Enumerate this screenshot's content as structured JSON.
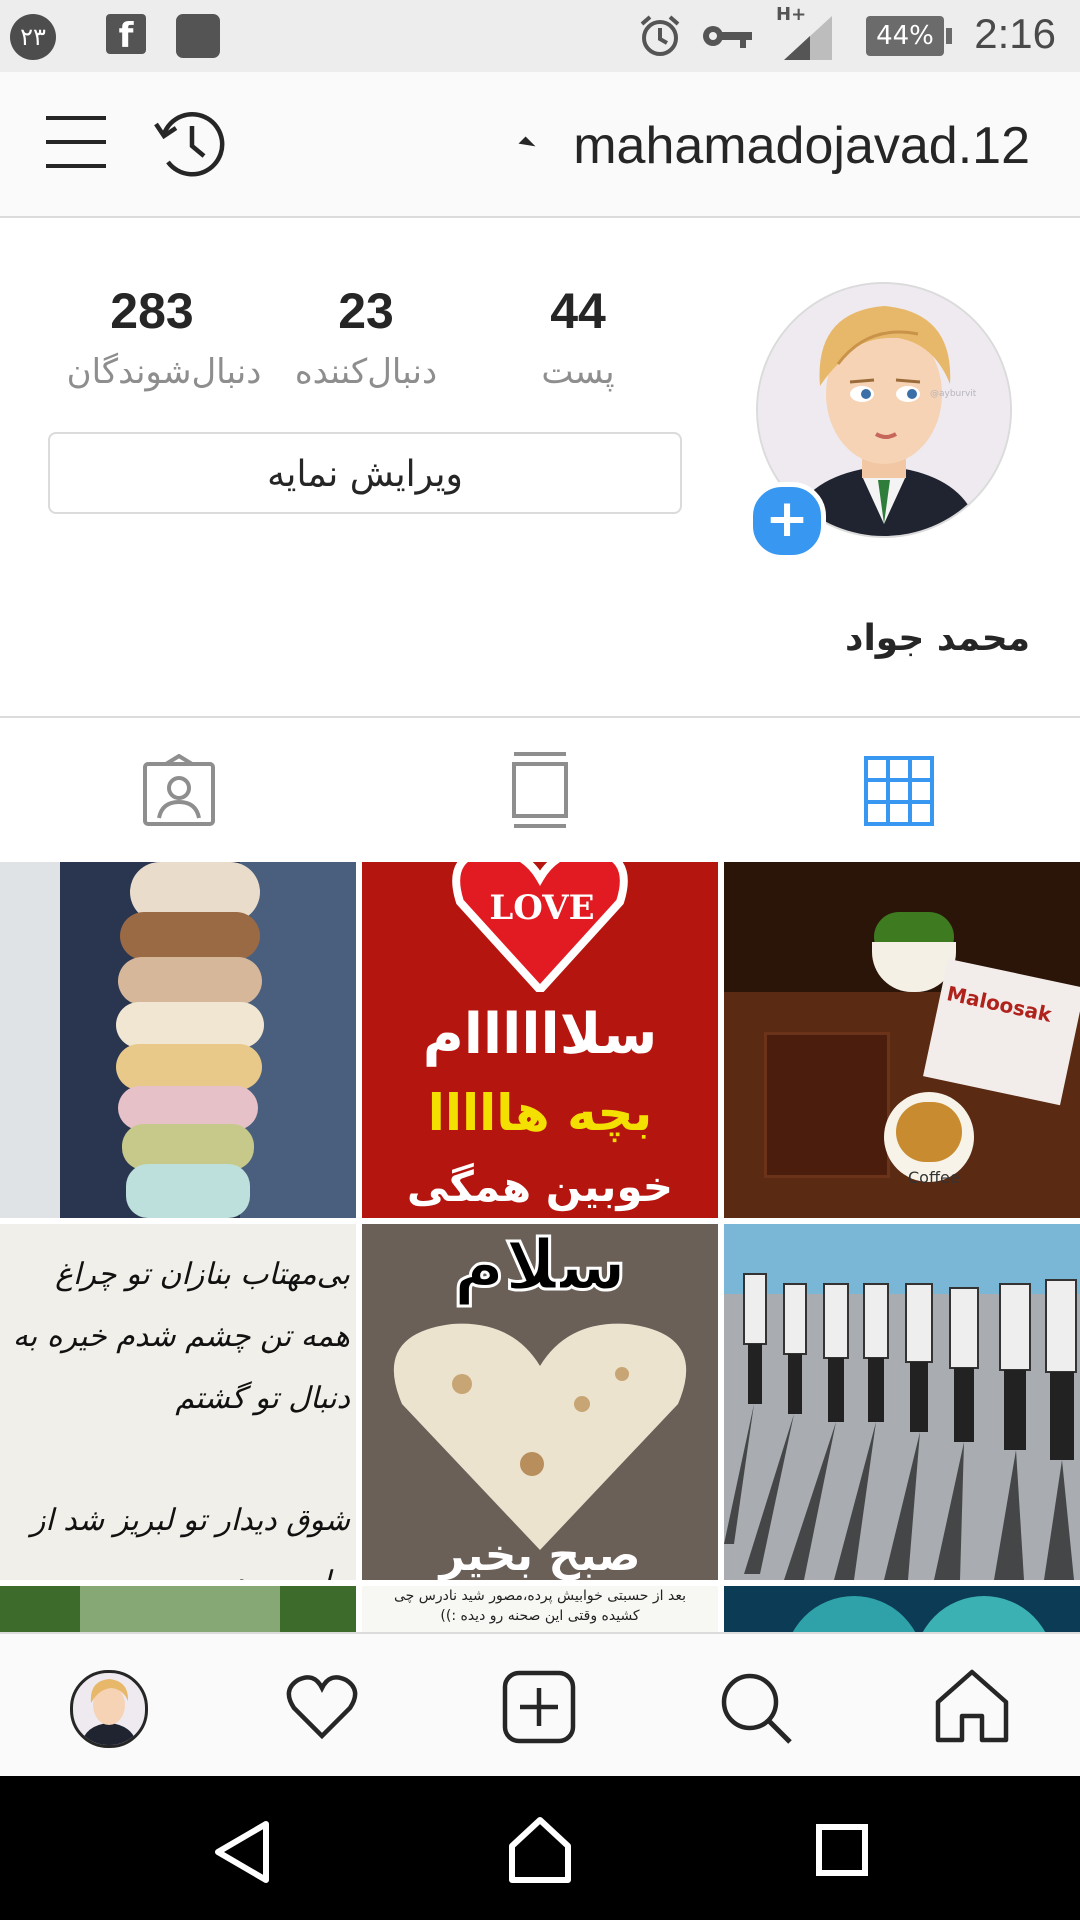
{
  "status_bar": {
    "notification_badge": "۲۳",
    "facebook_glyph": "f",
    "network": "H+",
    "battery": "44%",
    "time": "2:16"
  },
  "header": {
    "username": "mahamadojavad.12"
  },
  "profile": {
    "stats": [
      {
        "value": "44",
        "label": "پست"
      },
      {
        "value": "23",
        "label": "دنبال‌کننده"
      },
      {
        "value": "283",
        "label": "دنبال‌شوندگان"
      }
    ],
    "edit_button": "ویرایش نمایه",
    "full_name": "محمد جواد",
    "avatar_watermark": "@ayburvit"
  },
  "tabs": [
    "grid",
    "feed",
    "tagged"
  ],
  "grid_posts": [
    {
      "caption_lines": [
        "LOVE",
        "سلاااااام",
        "بچه هااااا",
        "خوبین همگی"
      ]
    },
    {
      "caption_lines": [
        "Maloosak",
        "Coffee"
      ]
    },
    {
      "caption_lines": [
        "سلام",
        "صبح بخیر"
      ]
    },
    {
      "caption_lines": [
        "بی‌مهتاب بنازان تو چراغ",
        "همه تن چشم شدم خیره به دنبال تو گشتم",
        "شوق دیدار تو لبریز شد از جام وجودم"
      ]
    },
    {
      "caption_lines": [
        "بعد از حسبتی خوابیش پرده،مصور شید نادرس چی",
        "کشیده وقتی این صحنه رو دیده :))"
      ]
    }
  ],
  "colors": {
    "accent": "#3897f0",
    "text": "#262626",
    "muted": "#8e8e8e",
    "border": "#dbdbdb"
  }
}
